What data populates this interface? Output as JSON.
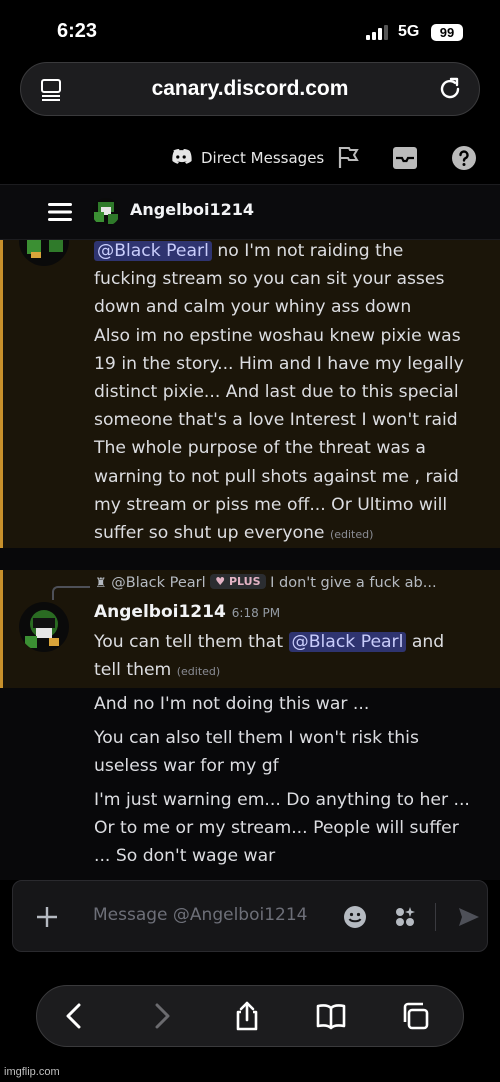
{
  "status_bar": {
    "time": "6:23",
    "network": "5G",
    "battery": "99"
  },
  "browser": {
    "url": "canary.discord.com"
  },
  "toolbar": {
    "dm_label": "Direct Messages"
  },
  "header": {
    "username": "Angelboi1214"
  },
  "message_1": {
    "mention": "@Black Pearl",
    "line0_rest": " no I'm not raiding the",
    "lines": [
      "fucking stream so you can sit your asses",
      "down and calm your whiny ass down",
      " Also im no epstine woshau knew pixie was",
      "19 in the story... Him and  I have my legally",
      "distinct pixie... And last due to this special",
      "someone that's a love Interest I won't raid",
      "The whole purpose of the threat was a",
      "warning to not pull shots against me , raid",
      "my stream or piss me off... Or Ultimo will"
    ],
    "last_line": "suffer so shut up everyone",
    "edited": "(edited)"
  },
  "message_2": {
    "reply_author": "@Black Pearl",
    "reply_badge": "PLUS",
    "reply_preview": "I don't give a fuck ab...",
    "author": "Angelboi1214",
    "timestamp": "6:18 PM",
    "text_before": "You can tell them that ",
    "mention": "@Black Pearl",
    "text_after": "  and",
    "line2": "tell them",
    "edited": "(edited)"
  },
  "followups": [
    {
      "lines": [
        "And no I'm not doing this war ..."
      ]
    },
    {
      "lines": [
        "You can also tell them I won't risk this",
        "useless war for my gf"
      ]
    },
    {
      "lines": [
        "I'm just warning em... Do anything to her ...",
        "Or to me or my stream... People will suffer",
        "... So don't wage war"
      ]
    }
  ],
  "composer": {
    "placeholder": "Message @Angelboi1214"
  },
  "watermark": "imgflip.com",
  "colors": {
    "mention_bg": "#2f3470",
    "highlight_border": "#c8902b",
    "highlight_bg": "#1b1509"
  },
  "icons": [
    "signal-icon",
    "page-icon",
    "reload-icon",
    "discord-icon",
    "flag-icon",
    "inbox-icon",
    "help-icon",
    "hamburger-icon",
    "avatar",
    "plus-icon",
    "emoji-icon",
    "apps-icon",
    "send-icon",
    "back-icon",
    "forward-icon",
    "share-icon",
    "bookmarks-icon",
    "tabs-icon"
  ]
}
